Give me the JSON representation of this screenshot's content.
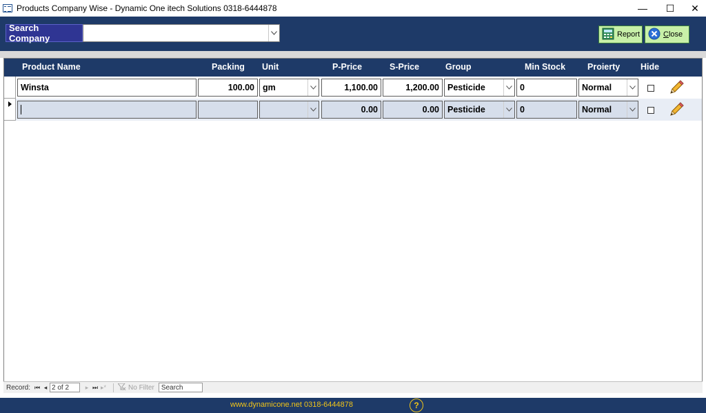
{
  "window": {
    "title": "Products Company Wise - Dynamic One itech Solutions 0318-6444878",
    "minimize": "—",
    "maximize": "☐",
    "close": "✕"
  },
  "header": {
    "search_label": "Search Company",
    "search_value": "",
    "report_label": "Report",
    "close_label": "Close",
    "close_hotkey": "C"
  },
  "grid": {
    "columns": [
      "Product Name",
      "Packing",
      "Unit",
      "P-Price",
      "S-Price",
      "Group",
      "Min Stock",
      "Proierty",
      "Hide"
    ],
    "rows": [
      {
        "product_name": "Winsta",
        "packing": "100.00",
        "unit": "gm",
        "p_price": "1,100.00",
        "s_price": "1,200.00",
        "group": "Pesticide",
        "min_stock": "0",
        "priority": "Normal",
        "hide": false
      },
      {
        "product_name": "",
        "packing": "",
        "unit": "",
        "p_price": "0.00",
        "s_price": "0.00",
        "group": "Pesticide",
        "min_stock": "0",
        "priority": "Normal",
        "hide": false
      }
    ]
  },
  "navigation": {
    "record_label": "Record:",
    "record_position": "2 of 2",
    "filter_label": "No Filter",
    "search_label": "Search"
  },
  "footer": {
    "text": "www.dynamicone.net 0318-6444878",
    "help": "?"
  }
}
